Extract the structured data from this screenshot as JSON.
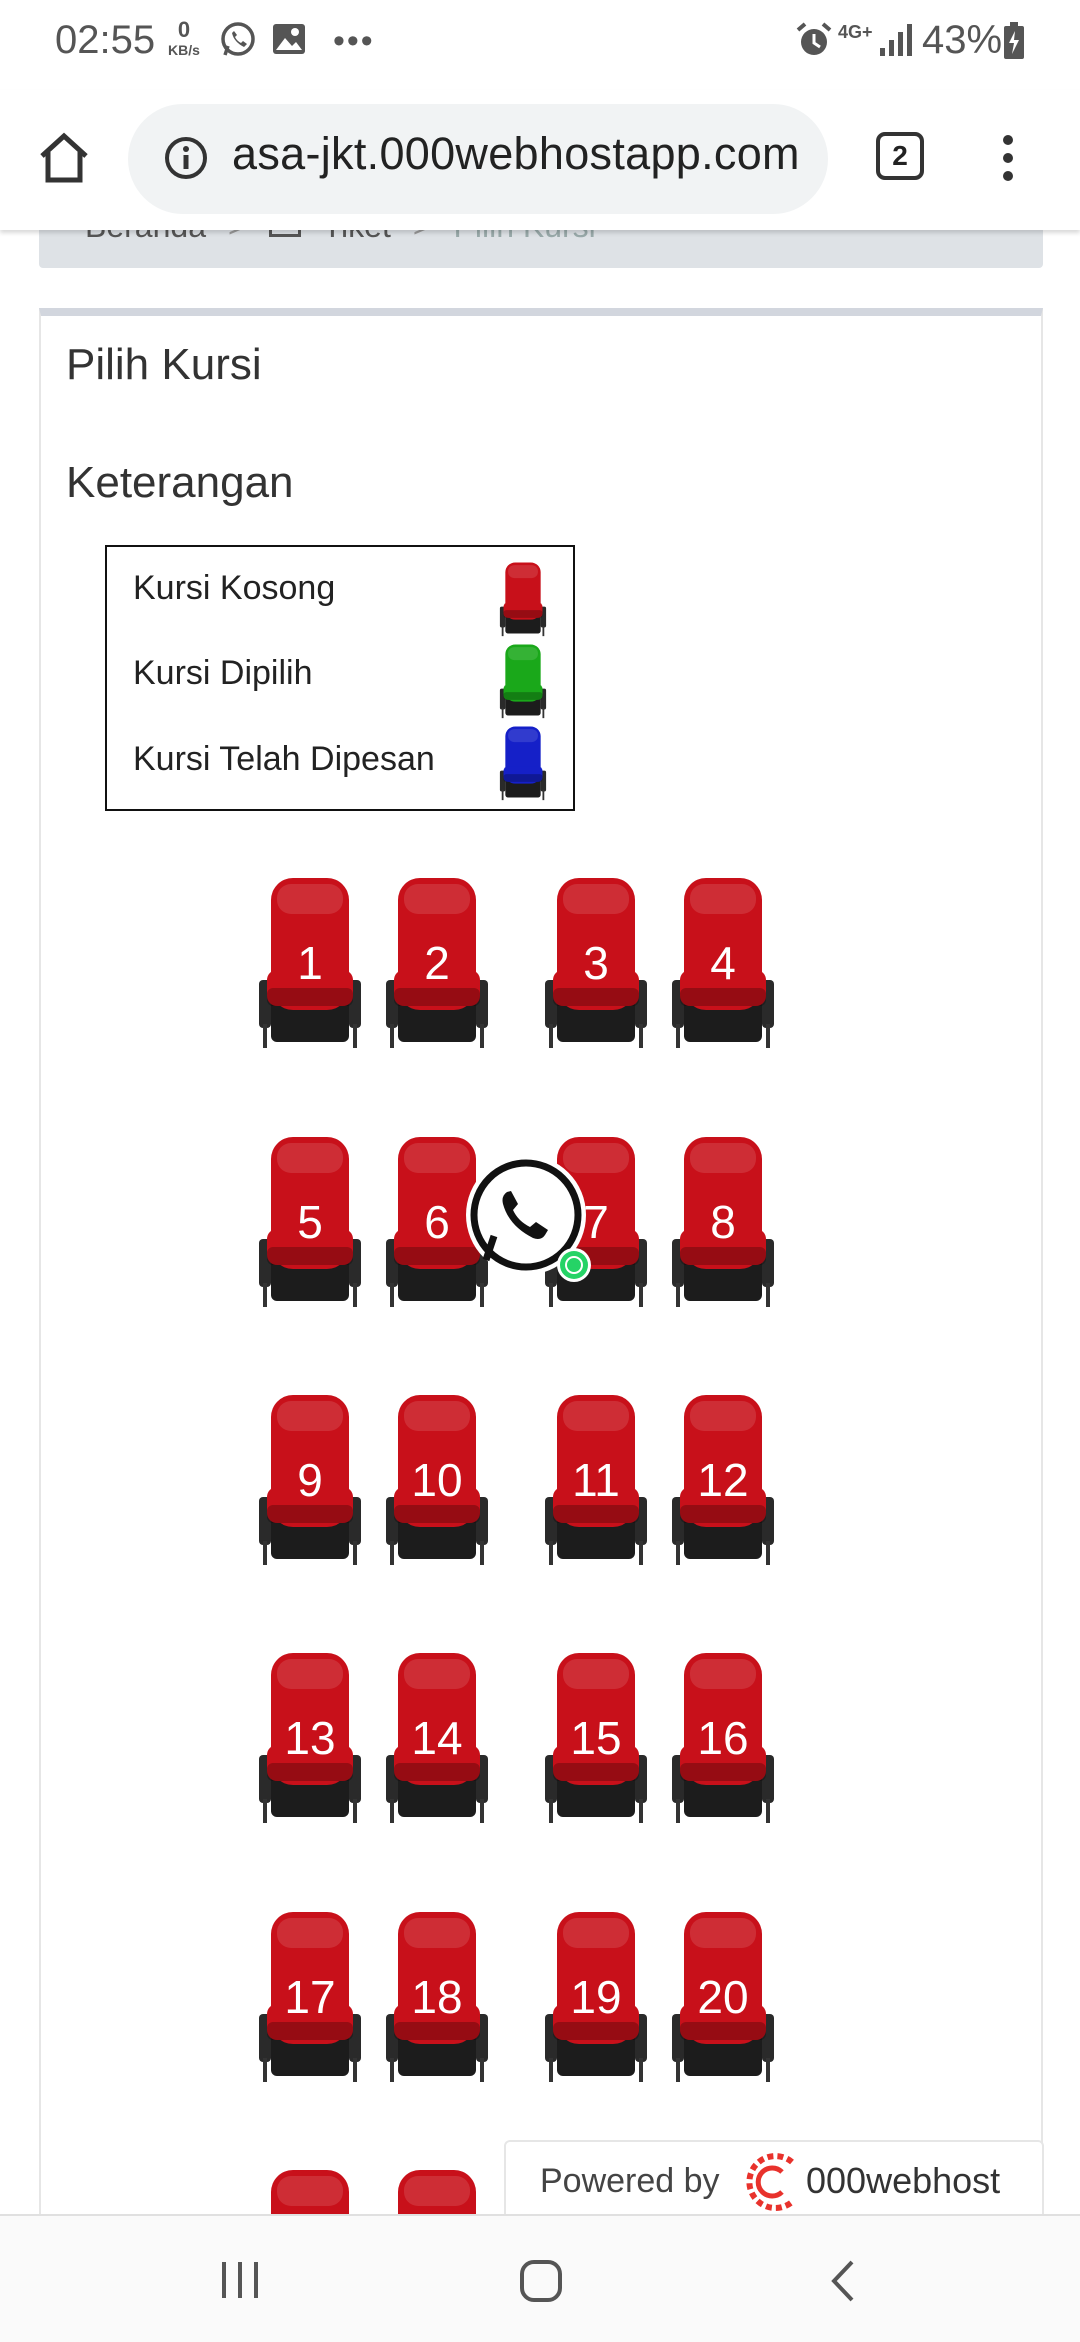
{
  "status_bar": {
    "time": "02:55",
    "net_speed_value": "0",
    "net_speed_unit": "KB/s",
    "network": "4G+",
    "battery": "43%"
  },
  "browser": {
    "url": "asa-jkt.000webhostapp.com",
    "tab_count": "2"
  },
  "breadcrumb": {
    "items": [
      "Beranda",
      "Tiket",
      "Pilih Kursi"
    ]
  },
  "page": {
    "title": "Pilih Kursi",
    "legend_title": "Keterangan",
    "legend": [
      {
        "label": "Kursi Kosong",
        "color": "#c8101a"
      },
      {
        "label": "Kursi Dipilih",
        "color": "#1aa81a"
      },
      {
        "label": "Kursi Telah Dipesan",
        "color": "#1520c8"
      }
    ]
  },
  "seats": {
    "color": "#c8101a",
    "numbers": [
      "1",
      "2",
      "3",
      "4",
      "5",
      "6",
      "7",
      "8",
      "9",
      "10",
      "11",
      "12",
      "13",
      "14",
      "15",
      "16",
      "17",
      "18",
      "19",
      "20"
    ]
  },
  "footer": {
    "powered_by": "Powered by",
    "brand": "000webhost"
  }
}
